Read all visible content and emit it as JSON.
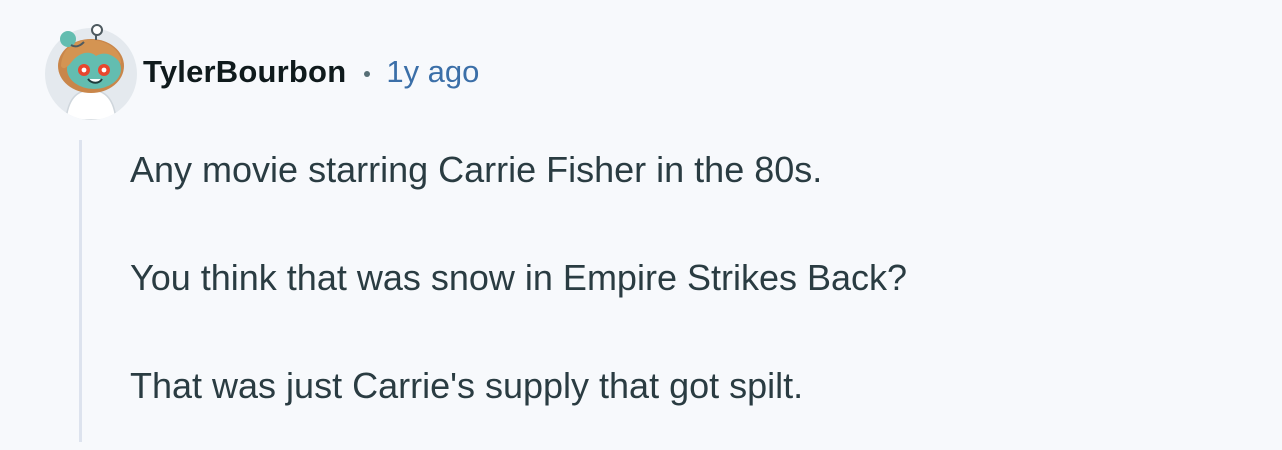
{
  "comment": {
    "author": "TylerBourbon",
    "separator": "•",
    "timestamp": "1y ago",
    "avatar_icon": "snoo-avatar-icon",
    "paragraphs": [
      "Any movie starring Carrie Fisher in the 80s.",
      "You think that was snow in Empire Strikes Back?",
      "That was just Carrie's supply that got spilt."
    ]
  },
  "colors": {
    "background": "#f7f9fc",
    "author": "#0f1a1c",
    "timestamp": "#3b6fa8",
    "body_text": "#2a3c42",
    "thread_line": "#dde3ee"
  }
}
